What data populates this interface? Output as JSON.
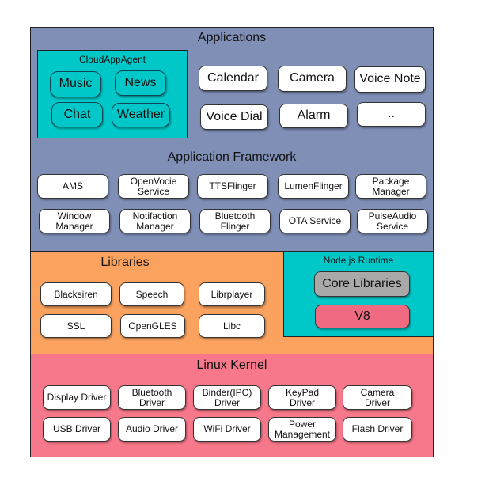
{
  "colors": {
    "applications": "#7f8fb6",
    "framework": "#7f8fb6",
    "libraries": "#fba25f",
    "nodejs": "#00c8c8",
    "kernel": "#f7788a",
    "cloud": "#00c8c8",
    "core": "#a9a9a9",
    "v8": "#f06b82"
  },
  "applications": {
    "title": "Applications",
    "cloud_agent": {
      "title": "CloudAppAgent",
      "items": [
        "Music",
        "News",
        "Chat",
        "Weather"
      ]
    },
    "items": [
      "Calendar",
      "Camera",
      "Voice Note",
      "Voice Dial",
      "Alarm",
      ".."
    ]
  },
  "framework": {
    "title": "Application Framework",
    "items": [
      "AMS",
      "OpenVocie\nService",
      "TTSFlinger",
      "LumenFlinger",
      "Package\nManager",
      "Window\nManager",
      "Notifaction\nManager",
      "Bluetooth\nFlinger",
      "OTA Service",
      "PulseAudio\nService"
    ]
  },
  "libraries": {
    "title": "Libraries",
    "items": [
      "Blacksiren",
      "Speech",
      "Librplayer",
      "SSL",
      "OpenGLES",
      "Libc"
    ]
  },
  "nodejs": {
    "title": "Node.js Runtime",
    "items": [
      "Core Libraries",
      "V8"
    ]
  },
  "kernel": {
    "title": "Linux Kernel",
    "items": [
      "Display Driver",
      "Bluetooth\nDriver",
      "Binder(IPC)\nDriver",
      "KeyPad\nDriver",
      "Camera\nDriver",
      "USB Driver",
      "Audio Driver",
      "WiFi Driver",
      "Power\nManagement",
      "Flash Driver"
    ]
  }
}
